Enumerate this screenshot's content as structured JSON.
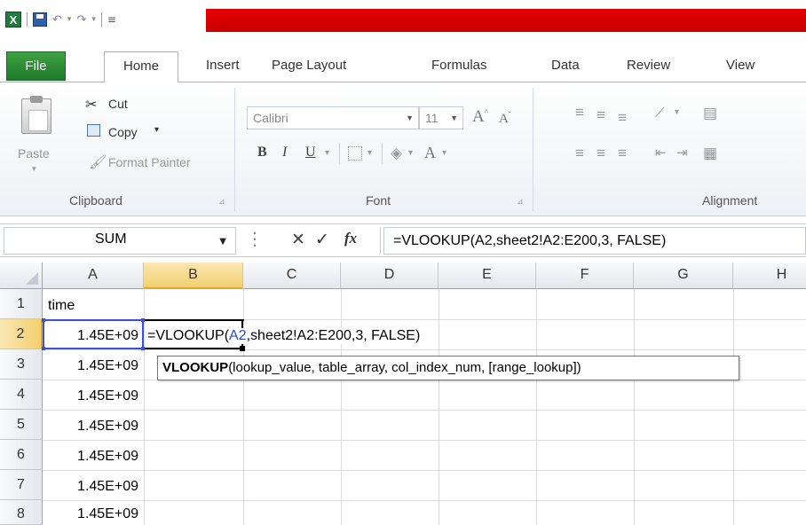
{
  "titlebar": {
    "app_icon_letter": "X"
  },
  "tabs": [
    "File",
    "Home",
    "Insert",
    "Page Layout",
    "Formulas",
    "Data",
    "Review",
    "View"
  ],
  "ribbon": {
    "clipboard": {
      "paste": "Paste",
      "cut": "Cut",
      "copy": "Copy",
      "format_painter": "Format Painter",
      "group_label": "Clipboard"
    },
    "font": {
      "font_name": "Calibri",
      "font_size": "11",
      "group_label": "Font"
    },
    "alignment": {
      "group_label": "Alignment"
    }
  },
  "formula_bar": {
    "name_box": "SUM",
    "fx": "fx",
    "formula": "=VLOOKUP(A2,sheet2!A2:E200,3, FALSE)"
  },
  "grid": {
    "columns": [
      "A",
      "B",
      "C",
      "D",
      "E",
      "F",
      "G",
      "H"
    ],
    "rows": [
      "1",
      "2",
      "3",
      "4",
      "5",
      "6",
      "7",
      "8"
    ],
    "a1": "time",
    "a_values": [
      "1.45E+09",
      "1.45E+09",
      "1.45E+09",
      "1.45E+09",
      "1.45E+09",
      "1.45E+09",
      "1.45E+09"
    ],
    "b2_prefix": "=VLOOKUP(",
    "b2_ref": "A2",
    "b2_suffix": ",sheet2!A2:E200,3, FALSE)"
  },
  "tooltip": {
    "func": "VLOOKUP",
    "args": "(lookup_value, table_array, col_index_num, [range_lookup])"
  },
  "colors": {
    "title_red": "#e60000",
    "file_tab_green": "#1d7a29",
    "selected_header": "#f3cf6e",
    "reference_blue": "#2a48d6"
  }
}
